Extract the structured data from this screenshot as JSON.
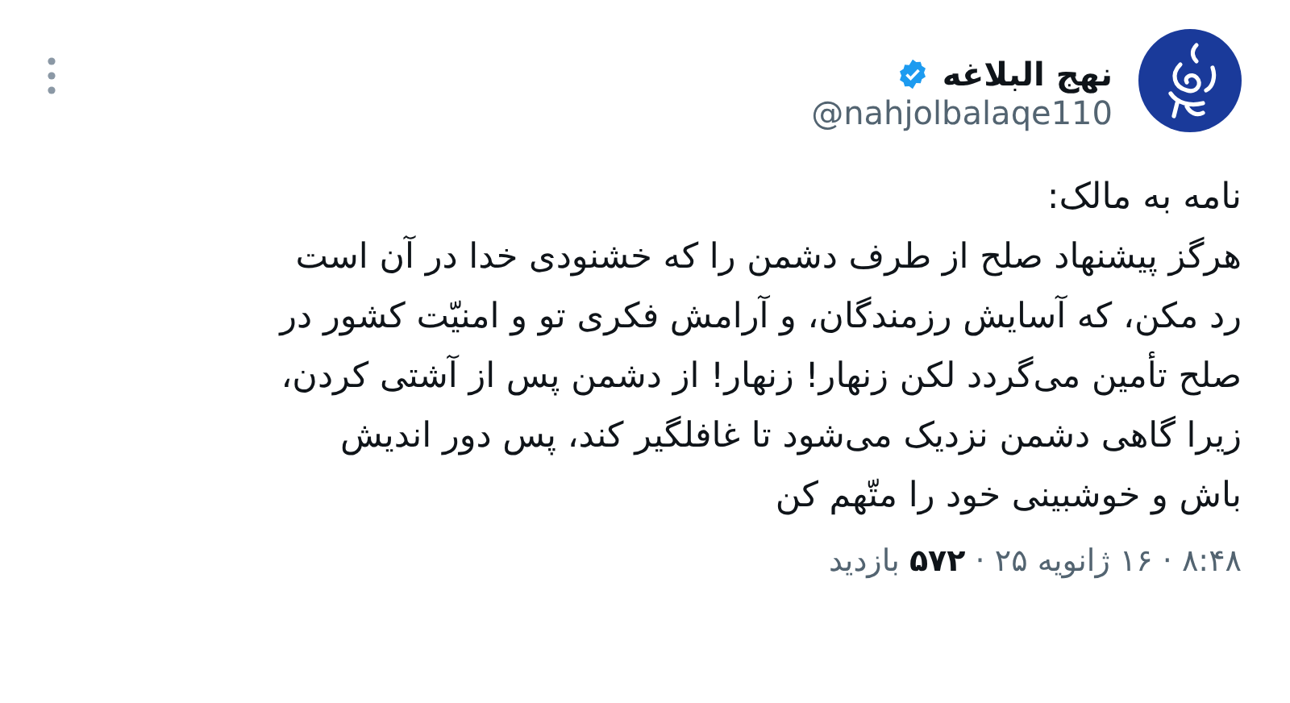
{
  "author": {
    "name": "نهج البلاغه",
    "verified": true,
    "handle": "@nahjolbalaqe110"
  },
  "post": {
    "title": "نامه به مالک:",
    "body": "هرگز پیشنهاد صلح از طرف دشمن را که خشنودی خدا در آن است\nرد مکن، که آسایش رزمندگان، و آرامش فکری تو و امنیّت کشور در\nصلح تأمین می‌گردد لکن زنهار! زنهار! از دشمن پس از آشتی کردن،\nزیرا گاهی دشمن نزدیک می‌شود تا غافلگیر کند، پس دور اندیش\nباش و خوشبینی خود را متّهم کن",
    "meta": "۸:۴۸ · ۱۶ ژانویه ۲۵ · **۵۷۲** بازدید"
  }
}
